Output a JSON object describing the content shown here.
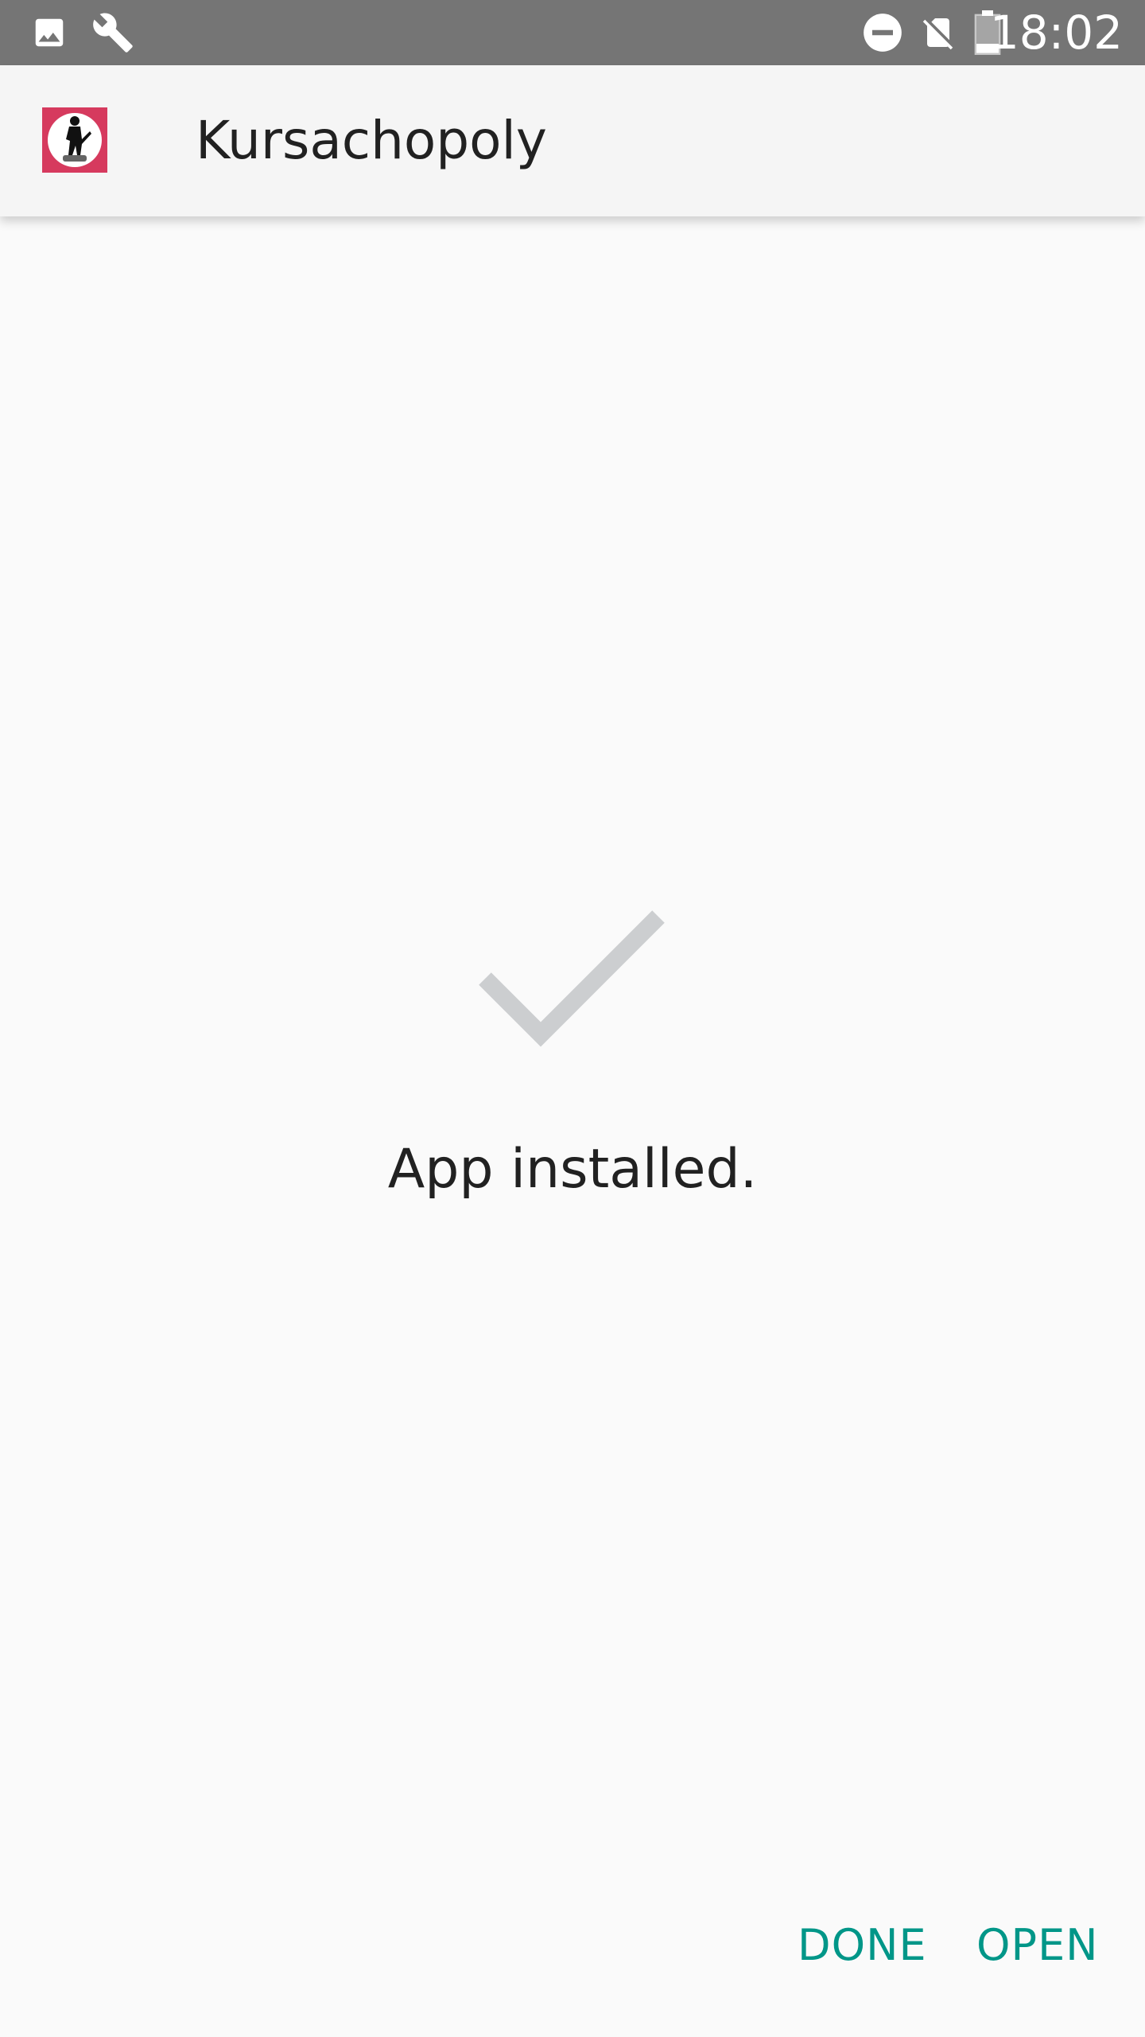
{
  "status_bar": {
    "time": "18:02",
    "left_icons": [
      "image-icon",
      "wrench-icon"
    ],
    "right_icons": [
      "do-not-disturb-icon",
      "no-sim-icon",
      "battery-icon"
    ]
  },
  "app_bar": {
    "app_name": "Kursachopoly",
    "app_icon": "app-logo-icon"
  },
  "main": {
    "status_icon": "checkmark-icon",
    "message": "App installed."
  },
  "actions": {
    "done_label": "DONE",
    "open_label": "OPEN"
  },
  "colors": {
    "status_bar": "#757575",
    "app_bar": "#f5f5f5",
    "background": "#fafafa",
    "accent": "#009688",
    "checkmark": "#ccced0",
    "app_icon_bg": "#d63a5e"
  }
}
